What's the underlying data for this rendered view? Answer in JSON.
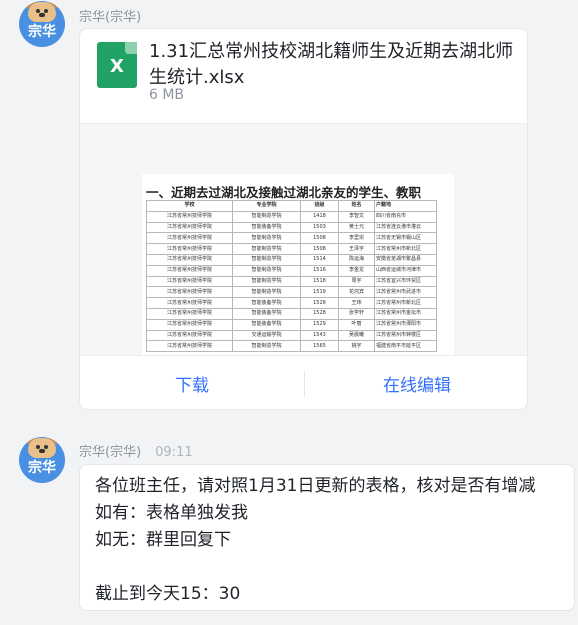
{
  "colors": {
    "accent": "#3370ff",
    "excel_green": "#21a366",
    "avatar_bg": "#4a90e2",
    "background": "#f2f3f5"
  },
  "messages": [
    {
      "avatar_text": "宗华",
      "sender": "宗华(宗华)",
      "time": "",
      "attachment": {
        "icon": "excel-file-icon",
        "icon_letter": "X",
        "name": "1.31汇总常州技校湖北籍师生及近期去湖北师生统计.xlsx",
        "size": "6 MB",
        "preview": {
          "sheet_title": "一、近期去过湖北及接触过湖北亲友的学生、教职",
          "headers": [
            "学校",
            "专业学院",
            "班级",
            "姓名",
            "户籍地"
          ],
          "rows": [
            [
              "江苏省常州技师学院",
              "智能制造学院",
              "1418",
              "李智文",
              "四川省南充市"
            ],
            [
              "江苏省常州技师学院",
              "智能装备学院",
              "1503",
              "黄士元",
              "江苏省连云港市灌云"
            ],
            [
              "江苏省常州技师学院",
              "智能制造学院",
              "1508",
              "李里宗",
              "江苏省无锡市锡山区"
            ],
            [
              "江苏省常州技师学院",
              "智能制造学院",
              "1508",
              "王泽宇",
              "江苏省常州市新北区"
            ],
            [
              "江苏省常州技师学院",
              "智能制造学院",
              "1514",
              "陈运海",
              "安徽省芜湖市繁昌县"
            ],
            [
              "江苏省常州技师学院",
              "智能制造学院",
              "1516",
              "李金龙",
              "山西省运城市河津市"
            ],
            [
              "江苏省常州技师学院",
              "智能制造学院",
              "1518",
              "周宇",
              "江苏省宜兴市环贸区"
            ],
            [
              "江苏省常州技师学院",
              "智能制造学院",
              "1519",
              "花鸿宾",
              "江苏省常州市武进市"
            ],
            [
              "江苏省常州技师学院",
              "智能装备学院",
              "1528",
              "王玮",
              "江苏省常州市新北区"
            ],
            [
              "江苏省常州技师学院",
              "智能装备学院",
              "1528",
              "张学轩",
              "江苏省常州市金坛市"
            ],
            [
              "江苏省常州技师学院",
              "智能装备学院",
              "1529",
              "叶丽",
              "江苏省常州市溧阳市"
            ],
            [
              "江苏省常州技师学院",
              "交通运输学院",
              "1543",
              "吴晨曦",
              "江苏省常州市钟楼区"
            ],
            [
              "江苏省常州技师学院",
              "智能制造学院",
              "1565",
              "姚宇",
              "福建省南平市延平区"
            ]
          ]
        },
        "actions": {
          "download": "下载",
          "online_edit": "在线编辑"
        }
      }
    },
    {
      "avatar_text": "宗华",
      "sender": "宗华(宗华)",
      "time": "09:11",
      "lines": [
        "各位班主任，请对照1月31日更新的表格，核对是否有增减",
        "如有：表格单独发我",
        "如无：群里回复下",
        "",
        "截止到今天15：30"
      ]
    }
  ]
}
